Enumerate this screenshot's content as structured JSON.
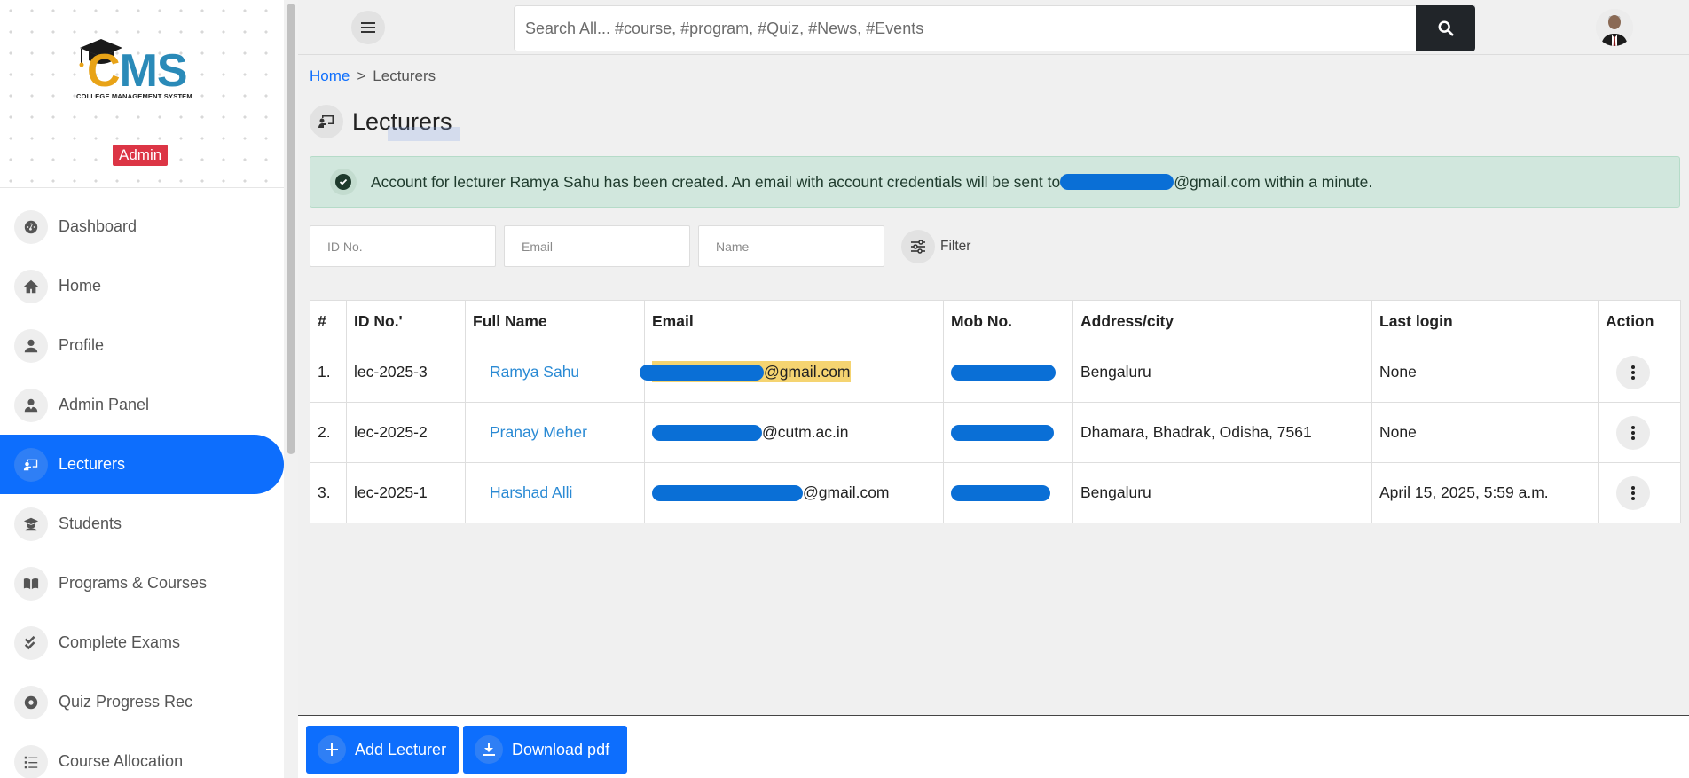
{
  "sidebar": {
    "logo": {
      "c": "C",
      "ms": "MS",
      "subtitle": "COLLEGE MANAGEMENT SYSTEM"
    },
    "role_badge": "Admin",
    "items": [
      {
        "label": "Dashboard",
        "icon": "dashboard-icon"
      },
      {
        "label": "Home",
        "icon": "home-icon"
      },
      {
        "label": "Profile",
        "icon": "user-icon"
      },
      {
        "label": "Admin Panel",
        "icon": "user-tie-icon"
      },
      {
        "label": "Lecturers",
        "icon": "chalkboard-teacher-icon",
        "active": true
      },
      {
        "label": "Students",
        "icon": "graduate-icon"
      },
      {
        "label": "Programs & Courses",
        "icon": "book-icon"
      },
      {
        "label": "Complete Exams",
        "icon": "check-double-icon"
      },
      {
        "label": "Quiz Progress Rec",
        "icon": "record-icon"
      },
      {
        "label": "Course Allocation",
        "icon": "list-icon"
      }
    ]
  },
  "topbar": {
    "search_placeholder": "Search All... #course, #program, #Quiz, #News, #Events"
  },
  "breadcrumb": {
    "home": "Home",
    "separator": ">",
    "current": "Lecturers"
  },
  "page_title": "Lecturers",
  "alert": {
    "before": "Account for lecturer Ramya Sahu has been created. An email with account credentials will be sent to",
    "after": "@gmail.com within a minute."
  },
  "filters": {
    "id_placeholder": "ID No.",
    "email_placeholder": "Email",
    "name_placeholder": "Name",
    "filter_label": "Filter"
  },
  "table": {
    "headers": [
      "#",
      "ID No.'",
      "Full Name",
      "Email",
      "Mob No.",
      "Address/city",
      "Last login",
      "Action"
    ],
    "rows": [
      {
        "num": "1.",
        "id": "lec-2025-3",
        "name": "Ramya Sahu",
        "email_domain": "@gmail.com",
        "address": "Bengaluru",
        "last_login": "None"
      },
      {
        "num": "2.",
        "id": "lec-2025-2",
        "name": "Pranay Meher",
        "email_domain": "@cutm.ac.in",
        "address": "Dhamara, Bhadrak, Odisha, 7561",
        "last_login": "None"
      },
      {
        "num": "3.",
        "id": "lec-2025-1",
        "name": "Harshad Alli",
        "email_domain": "@gmail.com",
        "address": "Bengaluru",
        "last_login": "April 15, 2025, 5:59 a.m."
      }
    ]
  },
  "footer": {
    "add_label": "Add Lecturer",
    "download_label": "Download pdf"
  },
  "colors": {
    "primary": "#0d6efd",
    "danger": "#dc3545",
    "success_bg": "#d1e7dd",
    "highlight": "#f5d471",
    "redaction": "#0a6fd6"
  }
}
